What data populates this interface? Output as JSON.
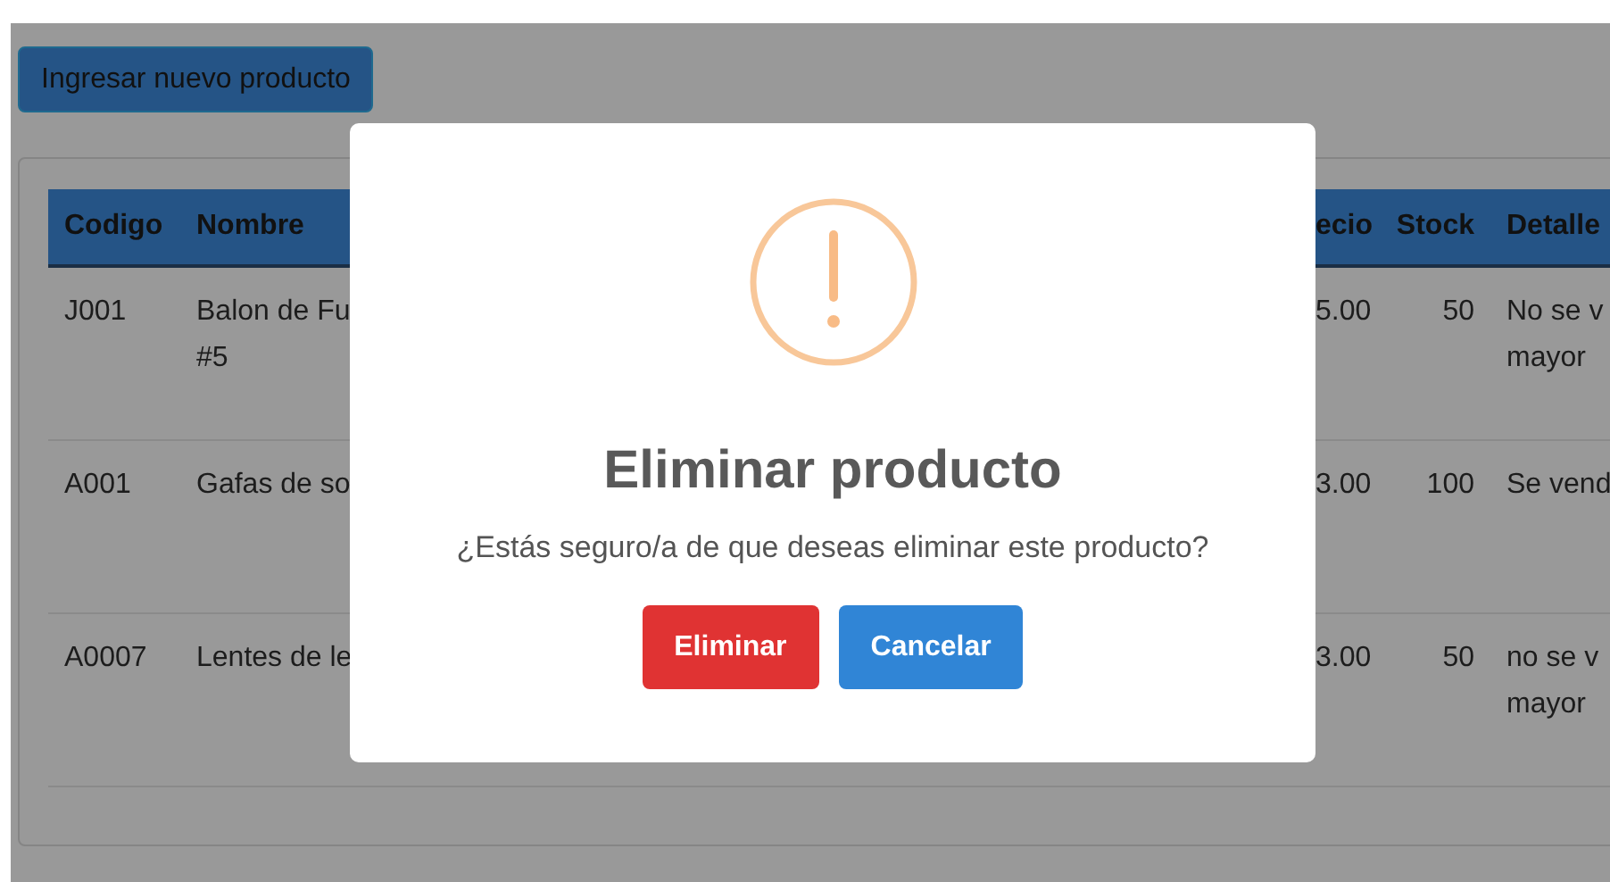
{
  "toolbar": {
    "new_button": "Ingresar nuevo producto"
  },
  "table": {
    "columns": [
      "Codigo",
      "Nombre",
      "ecio",
      "Stock",
      "Detalle"
    ],
    "rows": [
      {
        "cells": [
          [
            "J001"
          ],
          [
            "Balon de Fu",
            "#5"
          ],
          [
            "5.00"
          ],
          [
            "50"
          ],
          [
            "No se v",
            "mayor"
          ]
        ]
      },
      {
        "cells": [
          [
            "A001"
          ],
          [
            "Gafas de so"
          ],
          [
            "3.00"
          ],
          [
            "100"
          ],
          [
            "Se vend"
          ]
        ]
      },
      {
        "cells": [
          [
            "A0007"
          ],
          [
            "Lentes de le"
          ],
          [
            "3.00"
          ],
          [
            "50"
          ],
          [
            "no se v",
            "mayor"
          ]
        ]
      }
    ]
  },
  "dialog": {
    "title": "Eliminar producto",
    "message": "¿Estás seguro/a de que deseas eliminar este producto?",
    "buttons": [
      {
        "label": "Eliminar",
        "kind": "danger"
      },
      {
        "label": "Cancelar",
        "kind": "secondary"
      }
    ]
  }
}
